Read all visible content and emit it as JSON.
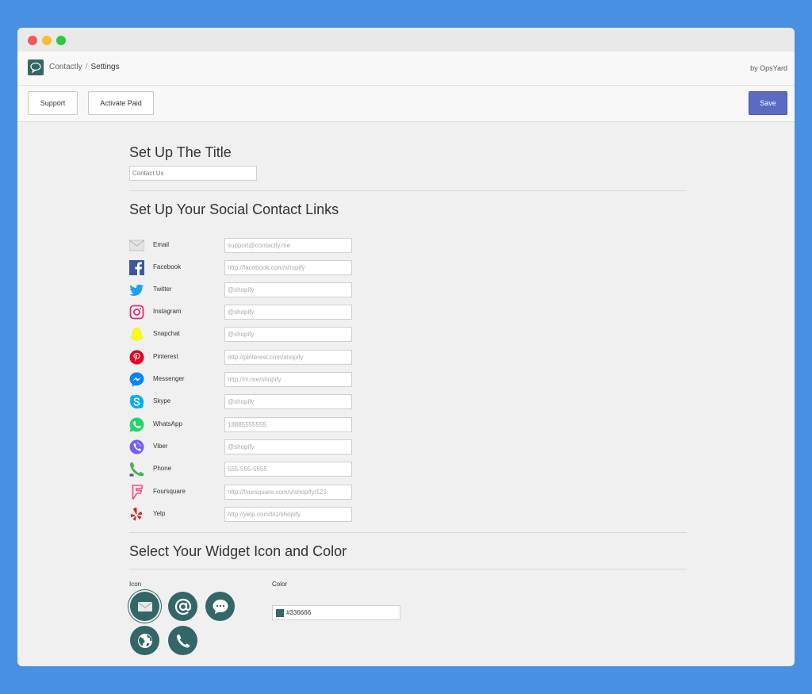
{
  "header": {
    "app_name": "Contactly",
    "separator": "/",
    "page": "Settings",
    "by": "by OpsYard"
  },
  "toolbar": {
    "support_label": "Support",
    "activate_label": "Activate Paid",
    "save_label": "Save"
  },
  "title_section": {
    "heading": "Set Up The Title",
    "placeholder": "Contact Us"
  },
  "social_section": {
    "heading": "Set Up Your Social Contact Links",
    "links": [
      {
        "label": "Email",
        "placeholder": "support@contactly.me",
        "icon": "email-icon"
      },
      {
        "label": "Facebook",
        "placeholder": "http://facebook.com/shopify",
        "icon": "facebook-icon"
      },
      {
        "label": "Twitter",
        "placeholder": "@shopify",
        "icon": "twitter-icon"
      },
      {
        "label": "Instagram",
        "placeholder": "@shopify",
        "icon": "instagram-icon"
      },
      {
        "label": "Snapchat",
        "placeholder": "@shopify",
        "icon": "snapchat-icon"
      },
      {
        "label": "Pinterest",
        "placeholder": "http://pinterest.com/shopify",
        "icon": "pinterest-icon"
      },
      {
        "label": "Messenger",
        "placeholder": "http://m.me/shopify",
        "icon": "messenger-icon"
      },
      {
        "label": "Skype",
        "placeholder": "@shopify",
        "icon": "skype-icon"
      },
      {
        "label": "WhatsApp",
        "placeholder": "18885555555",
        "icon": "whatsapp-icon"
      },
      {
        "label": "Viber",
        "placeholder": "@shopify",
        "icon": "viber-icon"
      },
      {
        "label": "Phone",
        "placeholder": "555-555-5555",
        "icon": "phone-icon"
      },
      {
        "label": "Foursquare",
        "placeholder": "http://foursquare.com/v/shopify/123",
        "icon": "foursquare-icon"
      },
      {
        "label": "Yelp",
        "placeholder": "http://yelp.com/biz/shopify",
        "icon": "yelp-icon"
      }
    ]
  },
  "widget_section": {
    "heading": "Select Your Widget Icon and Color",
    "icon_label": "Icon",
    "color_label": "Color",
    "color_value": "#336666",
    "icons": [
      "envelope-icon",
      "at-sign-icon",
      "chat-bubble-icon",
      "globe-icon",
      "phone-icon"
    ],
    "selected_icon": "envelope-icon"
  },
  "colors": {
    "accent": "#5c6ac4",
    "widget": "#336666",
    "background": "#4a90e2"
  }
}
